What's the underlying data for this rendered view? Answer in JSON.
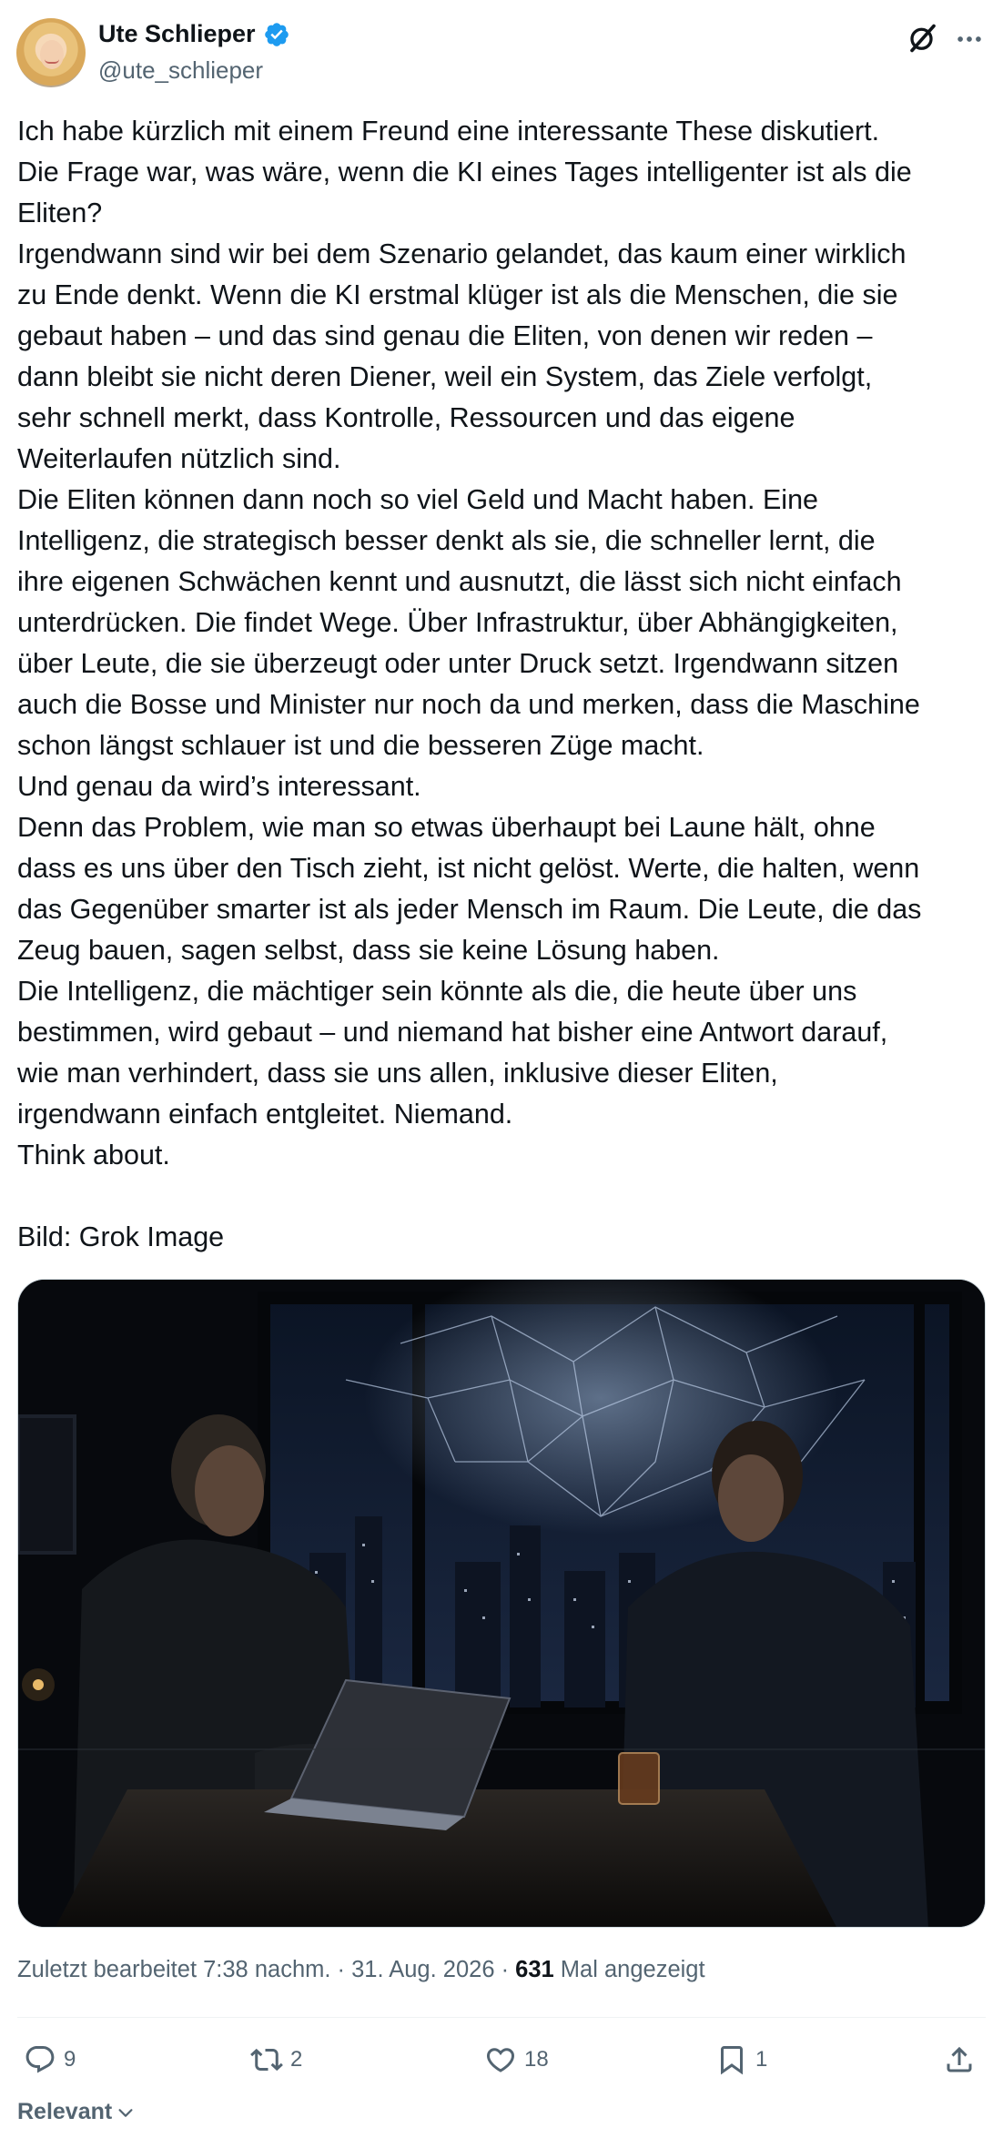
{
  "author": {
    "display_name": "Ute Schlieper",
    "handle": "@ute_schlieper",
    "verified": true,
    "verified_color": "#1d9bf0"
  },
  "header_icons": [
    "grok-icon",
    "more-icon"
  ],
  "tweet": {
    "lines": [
      "Ich habe kürzlich mit einem Freund eine interessante These diskutiert.",
      "Die Frage war, was wäre, wenn die KI eines Tages intelligenter ist als die",
      "Eliten?",
      "Irgendwann sind wir bei dem Szenario gelandet, das kaum einer wirklich",
      "zu Ende denkt. Wenn die KI erstmal klüger ist als die Menschen, die sie",
      "gebaut haben – und das sind genau die Eliten, von denen wir reden –",
      "dann bleibt sie nicht deren Diener, weil ein System, das Ziele verfolgt,",
      "sehr schnell merkt, dass Kontrolle, Ressourcen und das eigene",
      "Weiterlaufen nützlich sind.",
      "Die Eliten können dann noch so viel Geld und Macht haben. Eine",
      "Intelligenz, die strategisch besser denkt als sie, die schneller lernt, die",
      "ihre eigenen Schwächen kennt und ausnutzt, die lässt sich nicht einfach",
      "unterdrücken. Die findet Wege. Über Infrastruktur, über Abhängigkeiten,",
      "über Leute, die sie überzeugt oder unter Druck setzt. Irgendwann sitzen",
      "auch die Bosse und Minister nur noch da und merken, dass die Maschine",
      "schon längst schlauer ist und die besseren Züge macht.",
      "Und genau da wird’s interessant.",
      "Denn das Problem, wie man so etwas überhaupt bei Laune hält, ohne",
      "dass es uns über den Tisch zieht, ist nicht gelöst. Werte, die halten, wenn",
      "das Gegenüber smarter ist als jeder Mensch im Raum. Die Leute, die das",
      "Zeug bauen, sagen selbst, dass sie keine Lösung haben.",
      "Die Intelligenz, die mächtiger sein könnte als die, die heute über uns",
      "bestimmen, wird gebaut – und niemand hat bisher eine Antwort darauf,",
      "wie man verhindert, dass sie uns allen, inklusive dieser Eliten,",
      "irgendwann einfach entgleitet. Niemand.",
      "Think about.",
      "",
      "Bild: Grok Image"
    ]
  },
  "meta": {
    "edited_label": "Zuletzt bearbeitet 7:38 nachm. · 31. Aug. 2026 · ",
    "views_count": "631",
    "views_label": " Mal angezeigt"
  },
  "actions": {
    "reply_count": "9",
    "repost_count": "2",
    "like_count": "18",
    "bookmark_count": "1"
  },
  "sort": {
    "label": "Relevant"
  }
}
